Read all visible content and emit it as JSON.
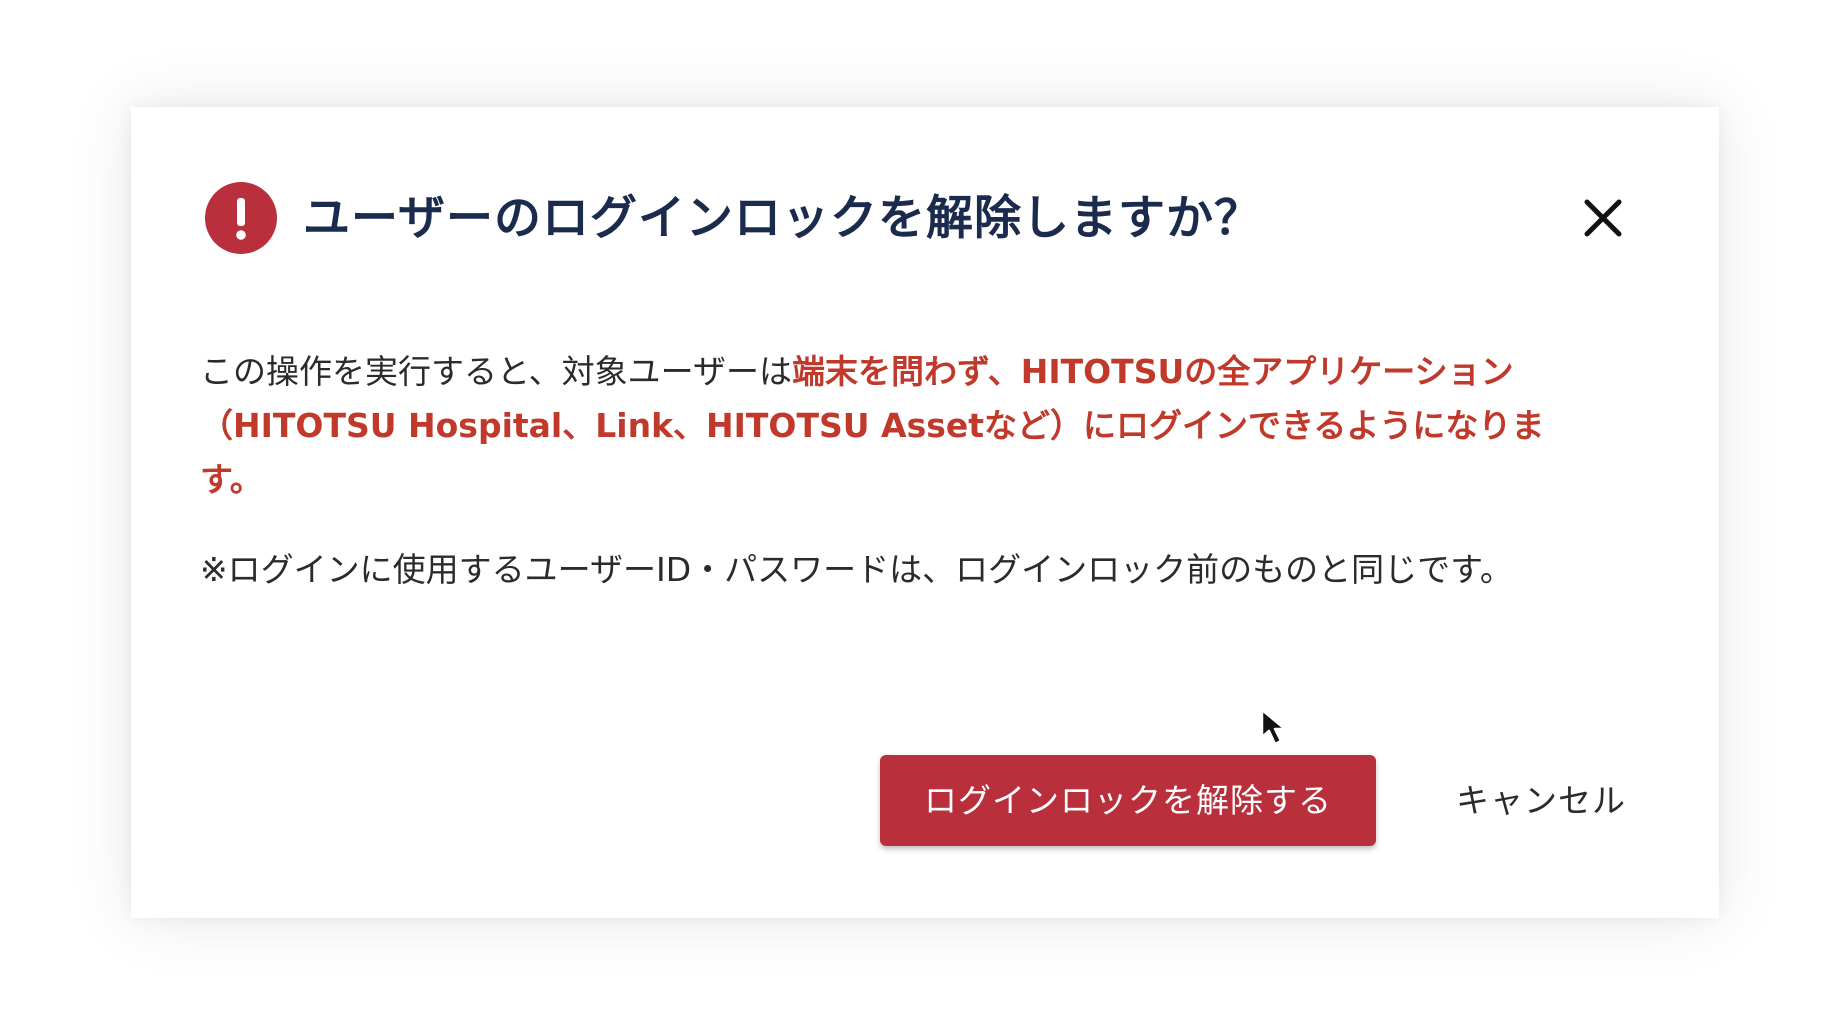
{
  "dialog": {
    "title": "ユーザーのログインロックを解除しますか？",
    "alert_icon": "exclamation-circle-icon",
    "close_icon": "close-icon",
    "body": {
      "line1_plain": "この操作を実行すると、対象ユーザーは",
      "line1_highlight": "端末を問わず、HITOTSUの全アプリケーション",
      "line2_highlight": "（HITOTSU Hospital、Link、HITOTSU Assetなど）にログインできるようになりま",
      "line3_highlight": "す。"
    },
    "note": "※ログインに使用するユーザーID・パスワードは、ログインロック前のものと同じです。",
    "primary_button_label": "ログインロックを解除する",
    "cancel_button_label": "キャンセル"
  },
  "colors": {
    "accent": "#b92f3c",
    "highlight_text": "#c0392b",
    "title_text": "#1b2b4d",
    "body_text": "#2b2b2b"
  },
  "cursor_icon": "mouse-pointer-icon"
}
